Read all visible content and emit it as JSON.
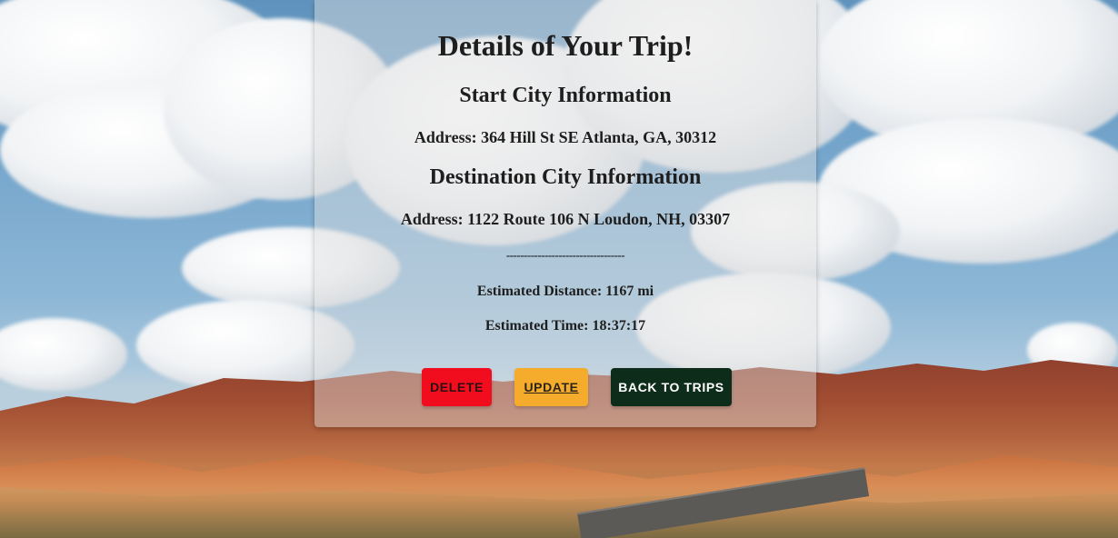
{
  "trip": {
    "title": "Details of Your Trip!",
    "start": {
      "heading": "Start City Information",
      "address": "Address: 364 Hill St SE Atlanta, GA, 30312"
    },
    "destination": {
      "heading": "Destination City Information",
      "address": "Address: 1122 Route 106 N Loudon, NH, 03307"
    },
    "divider": "----------------------------------",
    "distance": "Estimated Distance: 1167 mi",
    "time": "Estimated Time: 18:37:17"
  },
  "actions": {
    "delete_label": "DELETE",
    "update_label": "UPDATE",
    "back_label": "BACK TO TRIPS"
  },
  "colors": {
    "delete": "#f20d1e",
    "update": "#f5ab2c",
    "back": "#0d2c1a"
  }
}
